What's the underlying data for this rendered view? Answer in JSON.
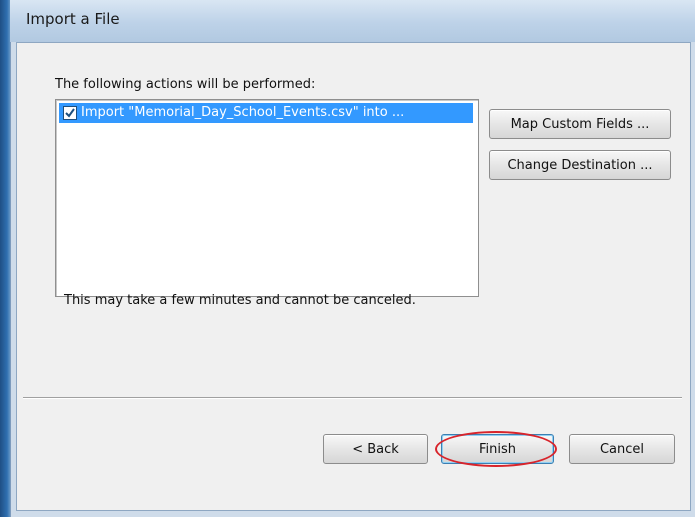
{
  "dialog": {
    "title": "Import a File",
    "actions_label": "The following actions will be performed:",
    "actions": [
      {
        "checked": true,
        "text": "Import \"Memorial_Day_School_Events.csv\" into ..."
      }
    ],
    "note": "This may take a few minutes and cannot be canceled.",
    "side_buttons": {
      "map_fields": "Map Custom Fields ...",
      "change_destination": "Change Destination ..."
    },
    "footer_buttons": {
      "back": "< Back",
      "finish": "Finish",
      "cancel": "Cancel"
    },
    "highlight_color": "#d8242b",
    "selection_color": "#3399ff"
  }
}
